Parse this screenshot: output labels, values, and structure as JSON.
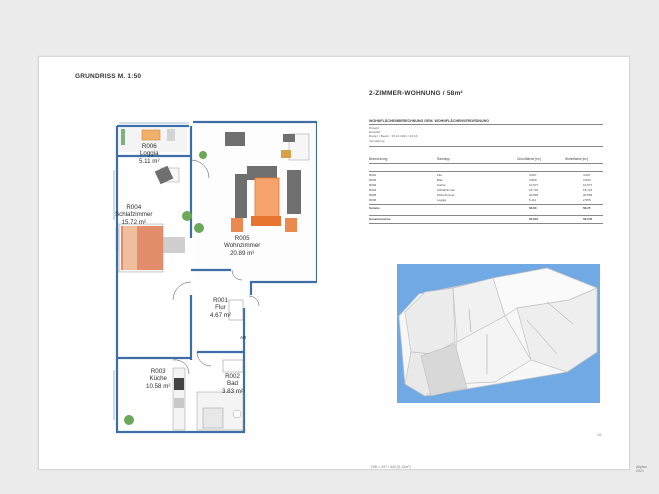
{
  "plan_title": "GRUNDRISS M. 1:50",
  "apartment_title": "2-ZIMMER-WOHNUNG / 58m²",
  "rooms": [
    {
      "id": "R006",
      "name": "Loggia",
      "area": "5.11 m²"
    },
    {
      "id": "R004",
      "name": "Schlafzimmer",
      "area": "15.72 m²"
    },
    {
      "id": "R005",
      "name": "Wohnzimmer",
      "area": "20.89 m²"
    },
    {
      "id": "R001",
      "name": "Flur",
      "area": "4.67 m²"
    },
    {
      "id": "R003",
      "name": "Küche",
      "area": "10.58 m²"
    },
    {
      "id": "R002",
      "name": "Bad",
      "area": "3.83 m²"
    }
  ],
  "closet_label": "AR",
  "calc": {
    "title": "WOHNFLÄCHENBERECHNUNG GEM. WOHNFLÄCHENVERORDNUNG",
    "meta": [
      "Projekt:",
      "Ersteller:",
      "Datum / Bearb.:  15.12.2021 / 10:16",
      "Verwaltung:"
    ],
    "headers": [
      "Bezeichnung",
      "Raumtyp",
      "Grundfläche [m²]",
      "Wohnfläche [m²]"
    ],
    "rows": [
      [
        "R001",
        "Flur",
        "4.667",
        "4.667"
      ],
      [
        "R002",
        "Bad",
        "3.830",
        "3.830"
      ],
      [
        "R003",
        "Küche",
        "10.577",
        "10.577"
      ],
      [
        "R004",
        "Schlafzimmer",
        "15.724",
        "15.724"
      ],
      [
        "R005",
        "Wohnzimmer",
        "20.893",
        "20.893"
      ],
      [
        "R006",
        "Loggia",
        "5.111",
        "2.555"
      ]
    ],
    "summe_label": "Summe",
    "summe_values": [
      "60.80",
      "58.25"
    ],
    "gesamt_label": "Gesamtsumme",
    "gesamt_values": [
      "60.801",
      "58.245"
    ]
  },
  "page_number": "1/1",
  "footer_scale": "H/B = 297 / 420 (0.12m²)",
  "footer_right": "Allplan 2021",
  "colors": {
    "wall": "#3d6fa6",
    "render_bg": "#70a9e4",
    "sofa": "#5b5b5b",
    "accent_orange": "#e8752f"
  }
}
